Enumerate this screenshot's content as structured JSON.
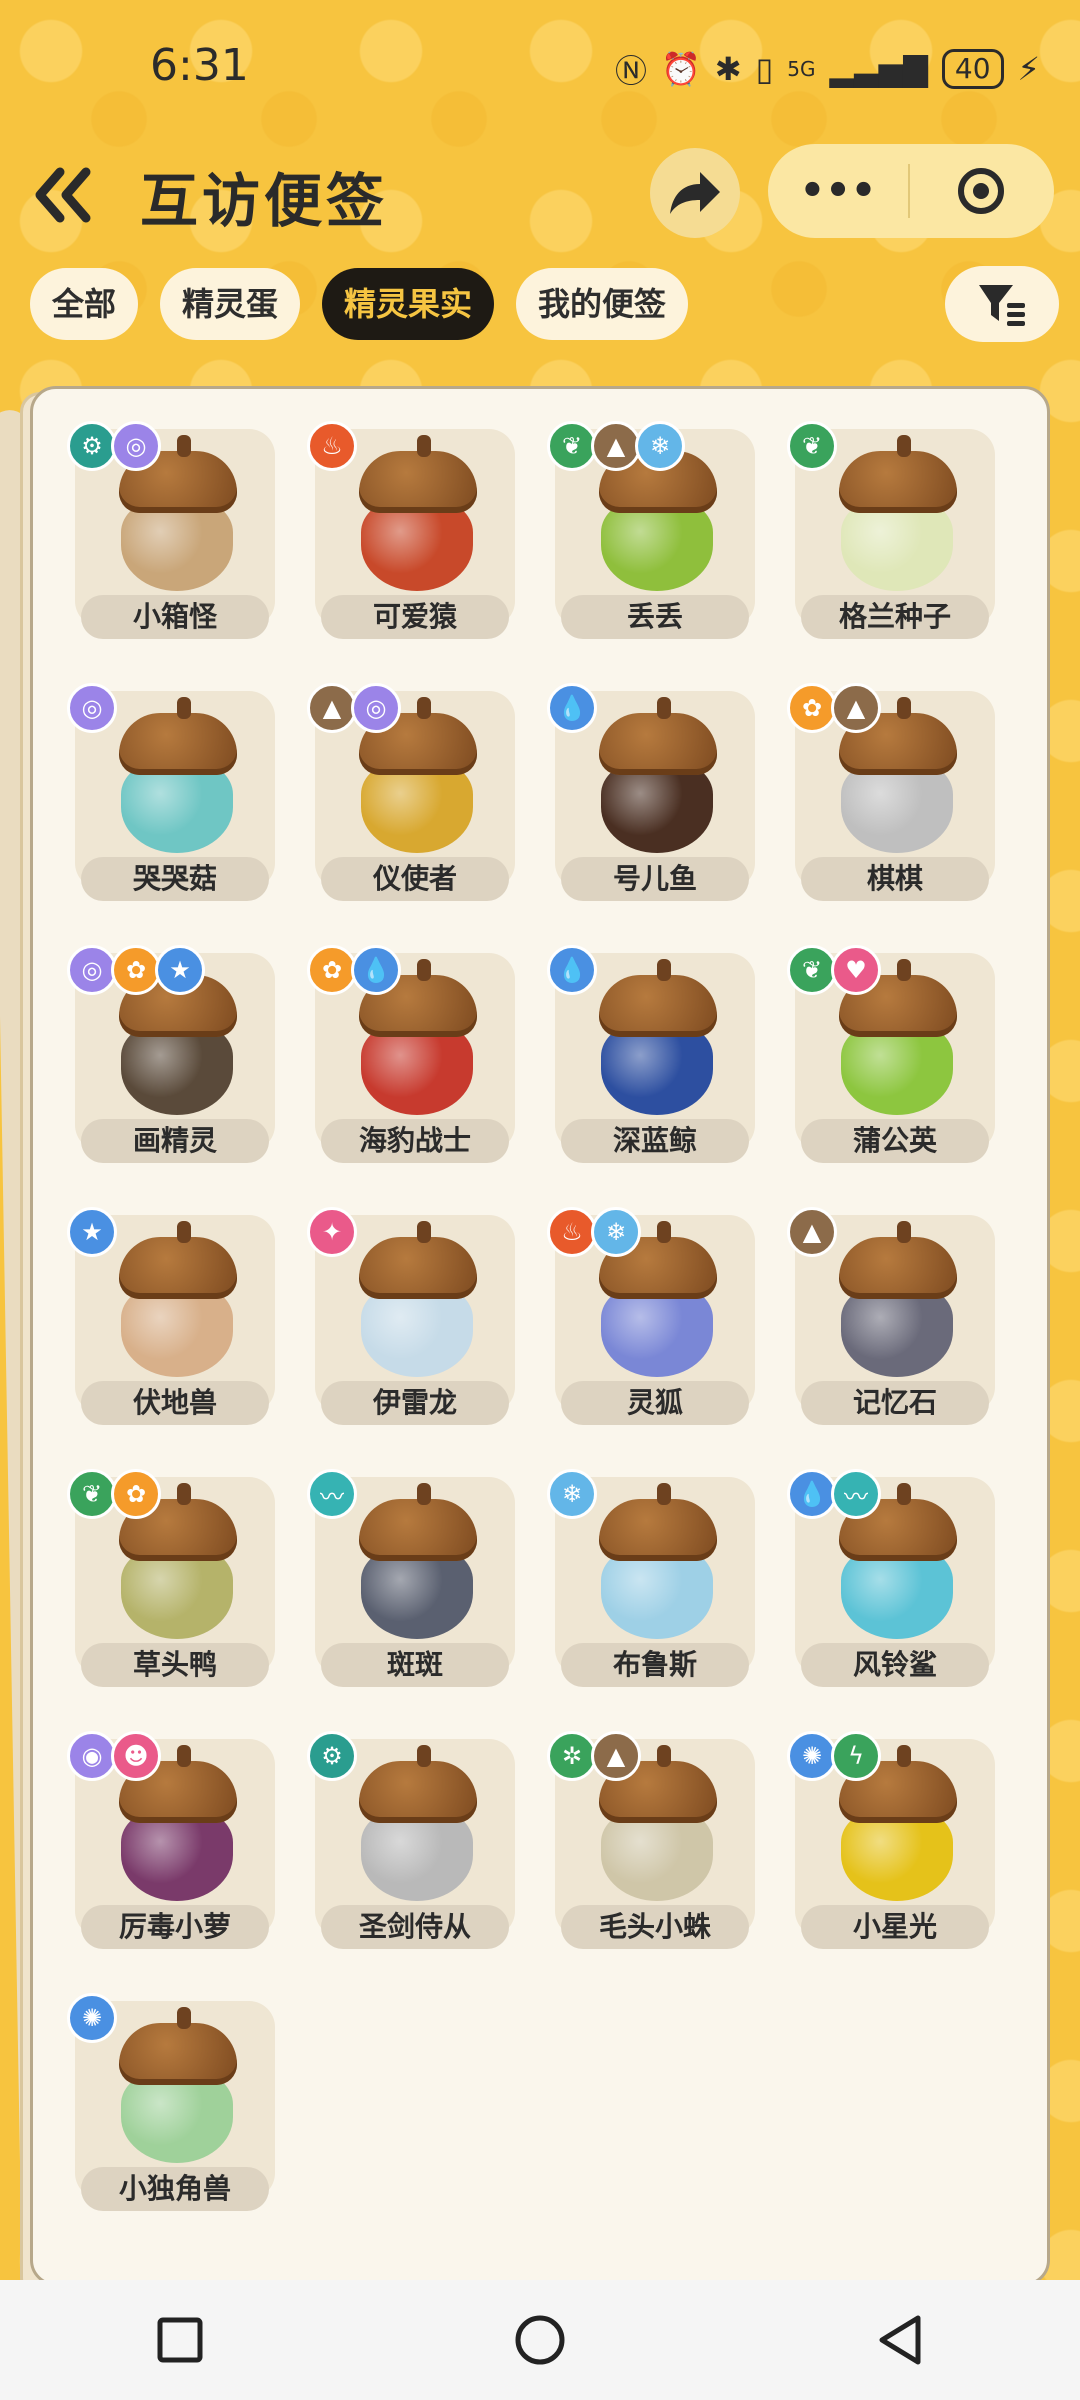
{
  "status": {
    "time": "6:31",
    "network": "5G",
    "battery": "40"
  },
  "header": {
    "title": "互访便签",
    "more": "•••"
  },
  "tabs": [
    "全部",
    "精灵蛋",
    "精灵果实",
    "我的便签"
  ],
  "active_tab": 2,
  "colors": {
    "brand": "#f6c542",
    "dark": "#1e1a14",
    "grass": "#3aa35c",
    "fire": "#e85a2b",
    "water": "#4a90e2",
    "ice": "#63b6e8",
    "ground": "#8c6b4a",
    "mech": "#2a9d8f",
    "fantasy": "#9b84e8",
    "light": "#f59b2a",
    "pink": "#ea5a8a",
    "wing": "#36b3b3"
  },
  "items": [
    {
      "name": "小箱怪",
      "badges": [
        "mechanism-icon",
        "swirl-icon"
      ],
      "fruit": "#c9a679"
    },
    {
      "name": "可爱猿",
      "badges": [
        "fire-icon"
      ],
      "fruit": "#c8492a"
    },
    {
      "name": "丢丢",
      "badges": [
        "grass-icon",
        "mountain-icon",
        "snowflake-icon"
      ],
      "fruit": "#8fbf3c"
    },
    {
      "name": "格兰种子",
      "badges": [
        "grass-icon"
      ],
      "fruit": "#dfe7b8"
    },
    {
      "name": "哭哭菇",
      "badges": [
        "swirl-icon"
      ],
      "fruit": "#6fc6c4"
    },
    {
      "name": "仪使者",
      "badges": [
        "mountain-icon",
        "swirl-icon"
      ],
      "fruit": "#d8a830"
    },
    {
      "name": "号儿鱼",
      "badges": [
        "water-drop-icon"
      ],
      "fruit": "#4a2f22"
    },
    {
      "name": "棋棋",
      "badges": [
        "light-icon",
        "mountain-icon"
      ],
      "fruit": "#bfbfbf"
    },
    {
      "name": "画精灵",
      "badges": [
        "swirl-icon",
        "light-icon",
        "star-icon"
      ],
      "fruit": "#5a4a3a"
    },
    {
      "name": "海豹战士",
      "badges": [
        "light-icon",
        "water-drop-icon"
      ],
      "fruit": "#c73a2e"
    },
    {
      "name": "深蓝鲸",
      "badges": [
        "water-drop-icon"
      ],
      "fruit": "#2d4fa0"
    },
    {
      "name": "蒲公英",
      "badges": [
        "grass-icon",
        "heart-icon"
      ],
      "fruit": "#8dc63f"
    },
    {
      "name": "伏地兽",
      "badges": [
        "star-icon"
      ],
      "fruit": "#d8b08a"
    },
    {
      "name": "伊雷龙",
      "badges": [
        "dragon-icon"
      ],
      "fruit": "#c6dbe8"
    },
    {
      "name": "灵狐",
      "badges": [
        "fire-icon",
        "snowflake-icon"
      ],
      "fruit": "#7a87d6"
    },
    {
      "name": "记忆石",
      "badges": [
        "mountain-icon"
      ],
      "fruit": "#6a6a7a"
    },
    {
      "name": "草头鸭",
      "badges": [
        "grass-icon",
        "light-icon"
      ],
      "fruit": "#b5b36a"
    },
    {
      "name": "斑斑",
      "badges": [
        "wing-icon"
      ],
      "fruit": "#5a6070"
    },
    {
      "name": "布鲁斯",
      "badges": [
        "snowflake-icon"
      ],
      "fruit": "#9ed0e6"
    },
    {
      "name": "风铃鲨",
      "badges": [
        "water-drop-icon",
        "wing-icon"
      ],
      "fruit": "#5cc3d6"
    },
    {
      "name": "厉毒小萝",
      "badges": [
        "poison-icon",
        "demon-icon"
      ],
      "fruit": "#7a3a6a"
    },
    {
      "name": "圣剑侍从",
      "badges": [
        "mechanism-icon"
      ],
      "fruit": "#b9b9b9"
    },
    {
      "name": "毛头小蛛",
      "badges": [
        "bug-icon",
        "mountain-icon"
      ],
      "fruit": "#cfc6a8"
    },
    {
      "name": "小星光",
      "badges": [
        "light-burst-icon",
        "lightning-icon"
      ],
      "fruit": "#e5c21a"
    },
    {
      "name": "小独角兽",
      "badges": [
        "light-burst-icon"
      ],
      "fruit": "#9fd19a"
    }
  ]
}
